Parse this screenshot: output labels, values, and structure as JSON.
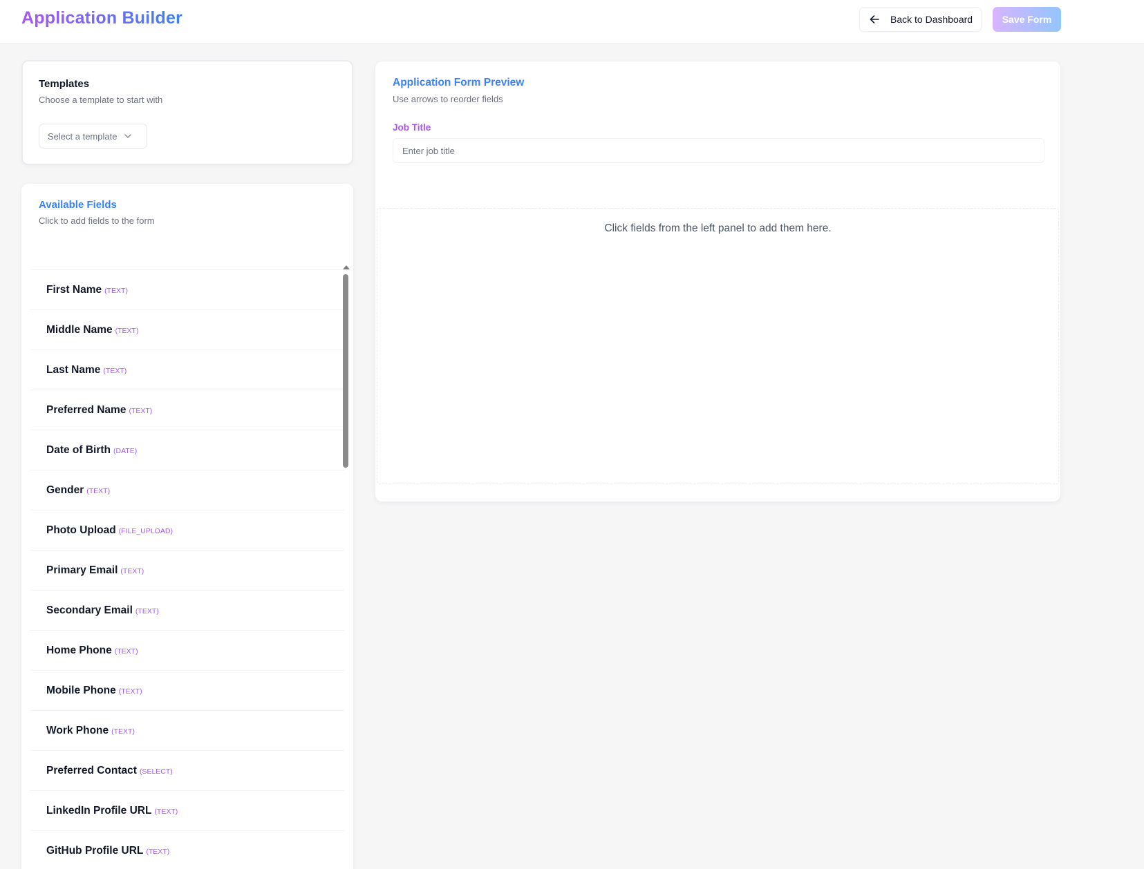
{
  "header": {
    "brand": "Application Builder",
    "back_label": "Back to Dashboard",
    "save_label": "Save Form"
  },
  "templates": {
    "title": "Templates",
    "subtitle": "Choose a template to start with",
    "select_value": "Select a template"
  },
  "fields_panel": {
    "title": "Available Fields",
    "subtitle": "Click to add fields to the form",
    "items": [
      {
        "name": "First Name",
        "type": "(TEXT)"
      },
      {
        "name": "Middle Name",
        "type": "(TEXT)"
      },
      {
        "name": "Last Name",
        "type": "(TEXT)"
      },
      {
        "name": "Preferred Name",
        "type": "(TEXT)"
      },
      {
        "name": "Date of Birth",
        "type": "(DATE)"
      },
      {
        "name": "Gender",
        "type": "(TEXT)"
      },
      {
        "name": "Photo Upload",
        "type": "(FILE_UPLOAD)"
      },
      {
        "name": "Primary Email",
        "type": "(TEXT)"
      },
      {
        "name": "Secondary Email",
        "type": "(TEXT)"
      },
      {
        "name": "Home Phone",
        "type": "(TEXT)"
      },
      {
        "name": "Mobile Phone",
        "type": "(TEXT)"
      },
      {
        "name": "Work Phone",
        "type": "(TEXT)"
      },
      {
        "name": "Preferred Contact",
        "type": "(SELECT)"
      },
      {
        "name": "LinkedIn Profile URL",
        "type": "(TEXT)"
      },
      {
        "name": "GitHub Profile URL",
        "type": "(TEXT)"
      }
    ]
  },
  "preview": {
    "title": "Application Form Preview",
    "subtitle": "Use arrows to reorder fields",
    "job_label": "Job Title",
    "job_placeholder": "Enter job title",
    "empty_text": "Click fields from the left panel to add them here."
  },
  "colors": {
    "brand_start": "#a855f7",
    "brand_end": "#3b82f6",
    "field_type": "#a855f7",
    "section_title": "#3b82f6"
  }
}
